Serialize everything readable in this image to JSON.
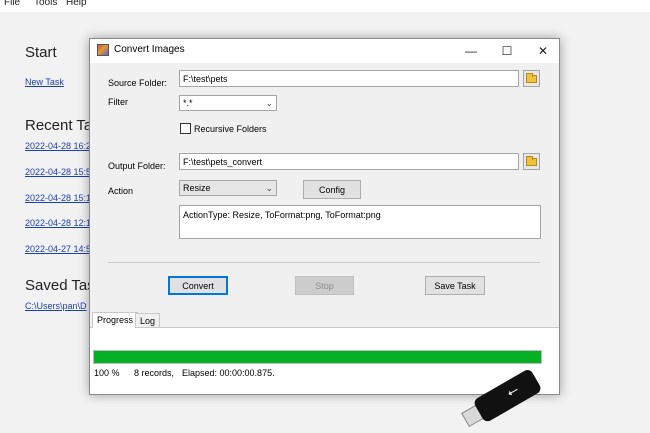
{
  "menu": {
    "file": "File",
    "tools": "Tools",
    "help": "Help"
  },
  "background": {
    "start_heading": "Start",
    "new_task": "New Task",
    "recent_heading": "Recent Tas",
    "recent": [
      "2022-04-28 16:2",
      "2022-04-28 15:5",
      "2022-04-28 15:1",
      "2022-04-28 12:1",
      "2022-04-27 14:5"
    ],
    "saved_heading": "Saved Task",
    "saved_path": "C:\\Users\\pan\\D"
  },
  "dialog": {
    "title": "Convert Images",
    "minimize": "—",
    "maximize": "☐",
    "close": "✕",
    "source_label": "Source Folder:",
    "source_value": "F:\\test\\pets",
    "filter_label": "Filter",
    "filter_value": "*.*",
    "recursive_label": "Recursive Folders",
    "output_label": "Output Folder:",
    "output_value": "F:\\test\\pets_convert",
    "action_label": "Action",
    "action_value": "Resize",
    "config_button": "Config",
    "action_details": "ActionType: Resize, ToFormat:png, ToFormat:png",
    "convert_button": "Convert",
    "stop_button": "Stop",
    "save_task_button": "Save Task",
    "tabs": [
      "Progress",
      "Log"
    ],
    "progress_percent": 100,
    "status_percent": "100 %",
    "status_records": "8 records,",
    "status_elapsed": "Elapsed: 00:00:00.875."
  },
  "colors": {
    "progress": "#06b025",
    "link": "#1a3fb0",
    "focus": "#0078d7"
  }
}
